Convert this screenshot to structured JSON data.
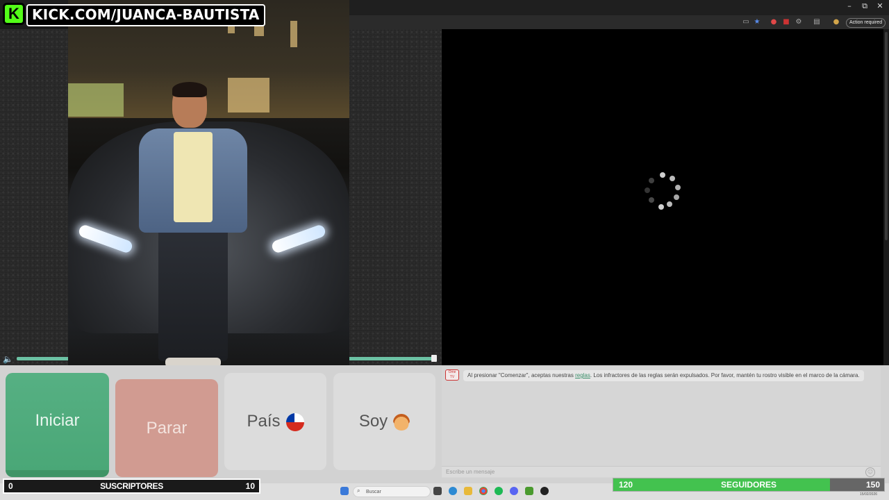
{
  "overlay": {
    "kick_url": "KICK.COM/JUANCA-BAUTISTA",
    "kick_badge": "K"
  },
  "browser": {
    "action_required": "Action required"
  },
  "controls": {
    "iniciar": "Iniciar",
    "parar": "Parar",
    "pais": "País",
    "soy": "Soy"
  },
  "chat": {
    "avatar_text": "Ome TV",
    "message_before": "Al presionar \"Comenzar\", aceptas nuestras ",
    "message_link": "reglas",
    "message_after": ". Los infractores de las reglas serán expulsados. Por favor, mantén tu rostro visible en el marco de la cámara.",
    "input_placeholder": "Escribe un mensaje"
  },
  "taskbar": {
    "search_placeholder": "Buscar",
    "date": "15/02/2026"
  },
  "subs": {
    "current": "0",
    "label": "SUSCRIPTORES",
    "goal": "10"
  },
  "followers": {
    "current": "120",
    "label": "SEGUIDORES",
    "goal": "150",
    "progress": 0.8
  },
  "volume": {
    "level": 1.0
  },
  "colors": {
    "kick_green": "#53fc18",
    "iniciar_green": "#4aa777",
    "parar_red": "#d19b91",
    "followers_green": "#43c24f"
  }
}
